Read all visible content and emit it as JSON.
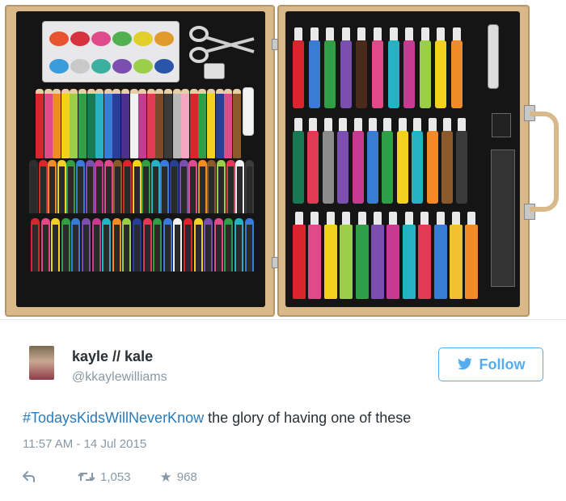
{
  "photo": {
    "watercolors": [
      "#e8542f",
      "#d6333e",
      "#e04a8a",
      "#52b04f",
      "#e3cf2b",
      "#e09a2c",
      "#3a9ddb",
      "#c9c9c9",
      "#3bb0a0",
      "#7a4fb0",
      "#9bcf4a",
      "#2a55a8"
    ],
    "pencils": [
      "#d9262e",
      "#e04a8a",
      "#f18b2a",
      "#f3d21f",
      "#9bcf4a",
      "#2f9e47",
      "#177a55",
      "#25b3c4",
      "#3a7bd5",
      "#283e99",
      "#4c2f8f",
      "#f2f2f2",
      "#c63a8f",
      "#e23a55",
      "#7a4a2a",
      "#3b3b3b",
      "#b8b8b8",
      "#f4a6c0",
      "#d9262e",
      "#2f9e47",
      "#f3d21f",
      "#283e99",
      "#e04a8a",
      "#8c5a2a"
    ],
    "crayons_top": [
      "#2f2f2f",
      "#d9262e",
      "#f18b2a",
      "#f3d21f",
      "#2f9e47",
      "#3a7bd5",
      "#7a4fb0",
      "#c63a8f",
      "#e04a8a",
      "#8c5a2a",
      "#d9262e",
      "#f3d21f",
      "#2f9e47",
      "#25b3c4",
      "#3a7bd5",
      "#283e99",
      "#7a4fb0",
      "#e04a8a",
      "#f18b2a",
      "#8c5a2a",
      "#9bcf4a",
      "#e23a55",
      "#f2f2f2",
      "#3b3b3b"
    ],
    "crayons_bottom": [
      "#d9262e",
      "#e04a8a",
      "#f3d21f",
      "#2f9e47",
      "#3a7bd5",
      "#7a4fb0",
      "#c63a8f",
      "#25b3c4",
      "#f18b2a",
      "#9bcf4a",
      "#283e99",
      "#e23a55",
      "#2f9e47",
      "#3a7bd5",
      "#f2f2f2",
      "#d9262e",
      "#f3d21f",
      "#7a4fb0",
      "#e04a8a",
      "#2f9e47",
      "#25b3c4",
      "#3a7bd5"
    ],
    "markers_row1": [
      "#d9262e",
      "#3a7bd5",
      "#2f9e47",
      "#7a4fb0",
      "#4a2a1a",
      "#e04a8a",
      "#25b3c4",
      "#c63a8f",
      "#9bcf4a",
      "#f3d21f",
      "#f18b2a"
    ],
    "markers_row2": [
      "#177a55",
      "#e23a55",
      "#8c8c8c",
      "#7a4fb0",
      "#c63a8f",
      "#3a7bd5",
      "#2f9e47",
      "#f3d21f",
      "#25b3c4",
      "#f18b2a",
      "#8c5a2a",
      "#3b3b3b"
    ],
    "tubes_row3": [
      "#d9262e",
      "#e04a8a",
      "#f3d21f",
      "#9bcf4a",
      "#2f9e47",
      "#7a4fb0",
      "#c63a8f",
      "#25b3c4",
      "#e23a55",
      "#3a7bd5",
      "#f2c12e",
      "#f18b2a"
    ]
  },
  "tweet": {
    "display_name": "kayle // kale",
    "username": "@kkaylewilliams",
    "follow_label": "Follow",
    "hashtag": "#TodaysKidsWillNeverKnow",
    "text": " the glory of having one of these",
    "timestamp": "11:57 AM - 14 Jul 2015",
    "retweets": "1,053",
    "favorites": "968",
    "colors": {
      "accent": "#55acee",
      "hashtag": "#2b7bb9",
      "muted": "#8899a6",
      "text": "#292f33"
    },
    "icons": [
      "reply-icon",
      "retweet-icon",
      "favorite-icon",
      "twitter-bird-icon"
    ]
  }
}
